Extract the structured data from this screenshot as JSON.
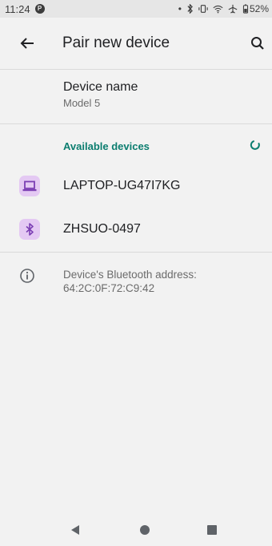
{
  "status_bar": {
    "time": "11:24",
    "battery": "52%"
  },
  "app_bar": {
    "title": "Pair new device"
  },
  "device_name": {
    "label": "Device name",
    "value": "Model 5"
  },
  "available_devices": {
    "header": "Available devices",
    "items": [
      {
        "name": "LAPTOP-UG47I7KG",
        "icon": "laptop-icon"
      },
      {
        "name": "ZHSUO-0497",
        "icon": "bluetooth-icon"
      }
    ]
  },
  "bluetooth_address": {
    "label": "Device's Bluetooth address:",
    "value": "64:2C:0F:72:C9:42"
  },
  "colors": {
    "accent": "#0b7d6f",
    "icon_bg": "#e4c9f3",
    "icon_fg": "#7b3fb3"
  },
  "nav": [
    "back-triangle-icon",
    "home-circle-icon",
    "recents-square-icon"
  ]
}
